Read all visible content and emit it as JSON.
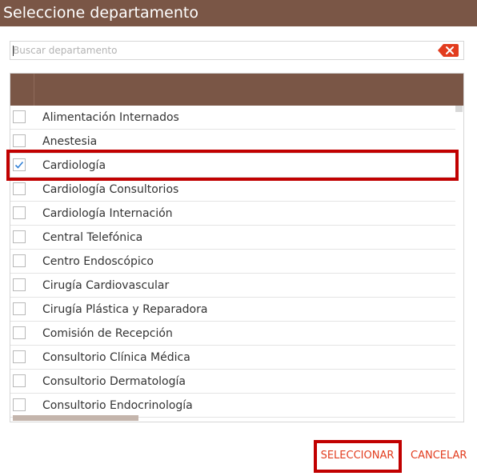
{
  "dialog": {
    "title": "Seleccione departamento"
  },
  "search": {
    "placeholder": "Buscar departamento",
    "value": ""
  },
  "list": {
    "items": [
      {
        "label": "Alimentación Internados",
        "checked": false
      },
      {
        "label": "Anestesia",
        "checked": false
      },
      {
        "label": "Cardiología",
        "checked": true
      },
      {
        "label": "Cardiología Consultorios",
        "checked": false
      },
      {
        "label": "Cardiología Internación",
        "checked": false
      },
      {
        "label": "Central Telefónica",
        "checked": false
      },
      {
        "label": "Centro Endoscópico",
        "checked": false
      },
      {
        "label": "Cirugía Cardiovascular",
        "checked": false
      },
      {
        "label": "Cirugía Plástica y Reparadora",
        "checked": false
      },
      {
        "label": "Comisión de Recepción",
        "checked": false
      },
      {
        "label": "Consultorio Clínica Médica",
        "checked": false
      },
      {
        "label": "Consultorio Dermatología",
        "checked": false
      },
      {
        "label": "Consultorio Endocrinología",
        "checked": false
      }
    ]
  },
  "footer": {
    "select_label": "SELECCIONAR",
    "cancel_label": "CANCELAR"
  },
  "colors": {
    "header": "#7a5646",
    "accent": "#e23c1e",
    "highlight": "#c10000",
    "check": "#2f7fd6"
  }
}
